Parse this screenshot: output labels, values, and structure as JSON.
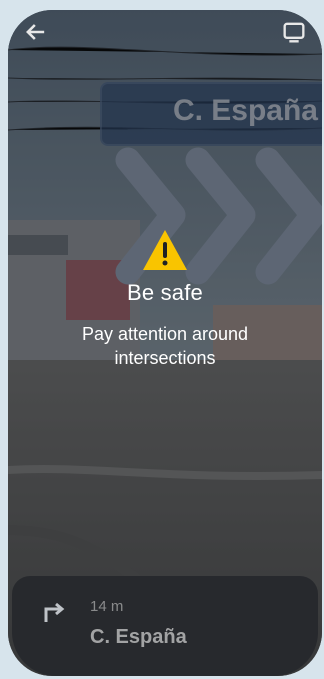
{
  "street_sign": {
    "text": "C. España"
  },
  "warning": {
    "title": "Be safe",
    "message": "Pay attention around intersections"
  },
  "nav_card": {
    "distance": "14 m",
    "street": "C. España"
  },
  "icons": {
    "back": "arrow-left-icon",
    "screen": "screen-icon",
    "warning": "warning-triangle-icon",
    "turn": "turn-right-icon"
  }
}
